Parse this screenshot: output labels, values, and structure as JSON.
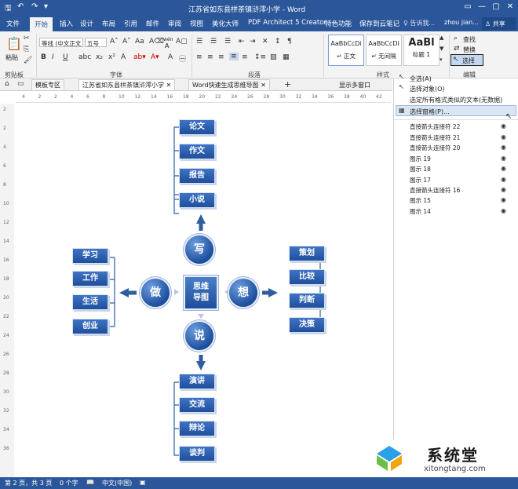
{
  "window": {
    "title": "江苏省如东县栟茶镇浒澪小学 - Word",
    "minimize": "—",
    "restore": "▢",
    "close": "✕"
  },
  "tabs": [
    {
      "label": "文件"
    },
    {
      "label": "开始"
    },
    {
      "label": "插入"
    },
    {
      "label": "设计"
    },
    {
      "label": "布局"
    },
    {
      "label": "引用"
    },
    {
      "label": "邮件"
    },
    {
      "label": "审阅"
    },
    {
      "label": "视图"
    },
    {
      "label": "美化大师"
    },
    {
      "label": "PDF Architect 5 Creator"
    },
    {
      "label": "特色功能"
    },
    {
      "label": "保存到云笔记"
    }
  ],
  "search": {
    "label": "♀ 告诉我..."
  },
  "user": {
    "name": "zhou jian..."
  },
  "share": {
    "label": "♙ 共享"
  },
  "ribbon": {
    "paste": "粘贴",
    "font_name": "等线 (中文正文",
    "font_size": "五号",
    "wen": "wén",
    "wen_a": "A",
    "groups": {
      "clipboard": "剪贴板",
      "font": "字体",
      "paragraph": "段落",
      "styles": "样式",
      "editing": "编辑"
    },
    "styles": [
      {
        "sample": "AaBbCcDi",
        "name": "↵ 正文"
      },
      {
        "sample": "AaBbCcDi",
        "name": "↵ 无间隔"
      },
      {
        "sample": "AaBl",
        "name": "标题 1"
      }
    ],
    "find": "查找",
    "replace": "替换",
    "select": "选择"
  },
  "doc_tabs": [
    {
      "label": "模板专区"
    },
    {
      "label": "江苏省如东县栟茶镇浒澪小学"
    },
    {
      "label": "Word快速生成思维导图"
    }
  ],
  "multi_window": "显示多窗口",
  "ruler_ticks": [
    "4",
    "2",
    "2",
    "4",
    "6",
    "8",
    "10",
    "12",
    "14",
    "16",
    "18",
    "20",
    "22",
    "24",
    "26",
    "28",
    "30",
    "32",
    "34",
    "36",
    "38",
    "40",
    "42"
  ],
  "vruler_ticks": [
    "2",
    "2",
    "4",
    "6",
    "8",
    "10",
    "12",
    "14",
    "16",
    "18",
    "20",
    "22",
    "24",
    "26",
    "28",
    "30",
    "32",
    "34",
    "36"
  ],
  "mindmap": {
    "center": [
      "思维",
      "导图"
    ],
    "branches": {
      "top": {
        "label": "写",
        "items": [
          "论文",
          "作文",
          "报告",
          "小说"
        ]
      },
      "left": {
        "label": "做",
        "items": [
          "学习",
          "工作",
          "生活",
          "创业"
        ]
      },
      "right": {
        "label": "想",
        "items": [
          "策划",
          "比较",
          "判断",
          "决策"
        ]
      },
      "bottom": {
        "label": "说",
        "items": [
          "演讲",
          "交流",
          "辩论",
          "谈判"
        ]
      }
    }
  },
  "select_menu": {
    "select_all": "全选(A)",
    "select_objects": "选择对象(O)",
    "select_similar": "选定所有格式类似的文本(无数据)",
    "selection_pane": "选择窗格(P)..."
  },
  "selection_list": [
    "直接箭头连接符 22",
    "直接箭头连接符 21",
    "直接箭头连接符 20",
    "图示 19",
    "图示 18",
    "图示 17",
    "直接箭头连接符 16",
    "图示 15",
    "图示 14"
  ],
  "status": {
    "page": "第 2 页，共 3 页",
    "words": "0 个字",
    "lang": "中文(中国)"
  },
  "watermark": {
    "brand": "系统堂",
    "url": "xitongtang.com"
  }
}
